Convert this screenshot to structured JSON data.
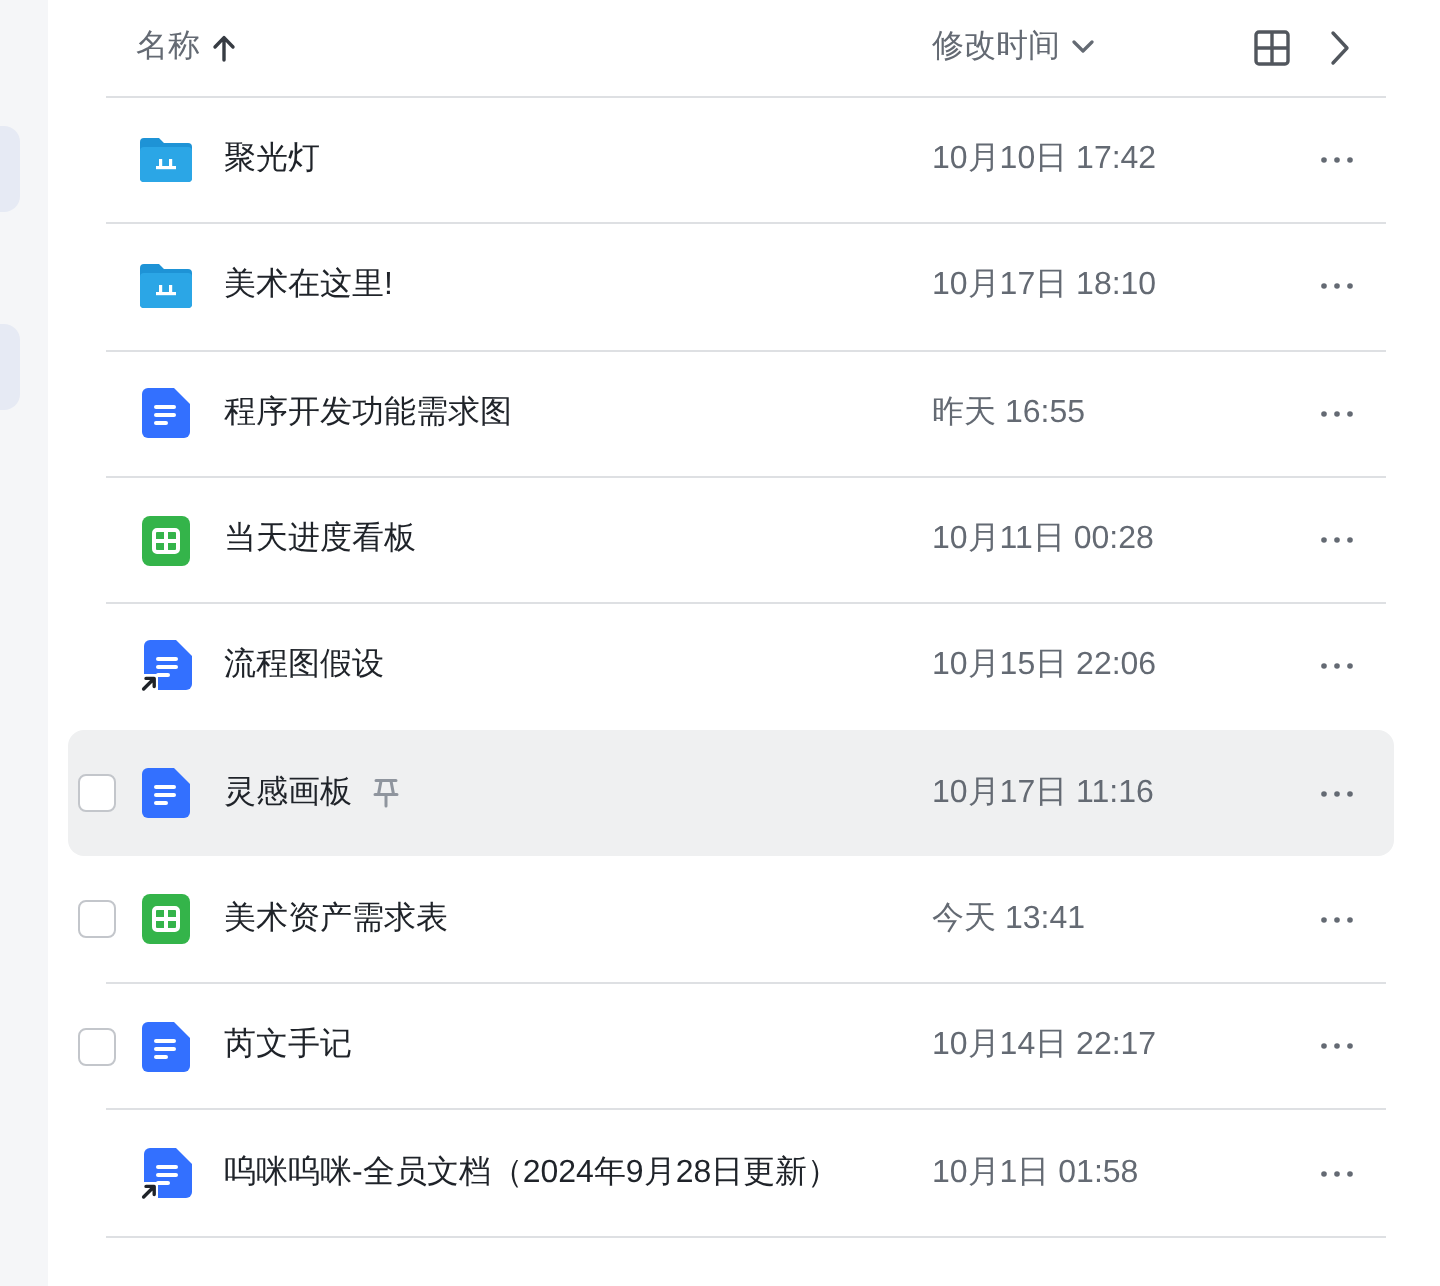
{
  "header": {
    "columns": [
      {
        "label": "名称",
        "sorted": true,
        "dropdown": false
      },
      {
        "label": "修改时间",
        "sorted": false,
        "dropdown": true
      }
    ]
  },
  "files": [
    {
      "name": "聚光灯",
      "kind": "shared-folder",
      "shortcut": false,
      "modified": "10月10日 17:42",
      "hovered": false
    },
    {
      "name": "美术在这里!",
      "kind": "shared-folder",
      "shortcut": false,
      "modified": "10月17日 18:10",
      "hovered": false
    },
    {
      "name": "程序开发功能需求图",
      "kind": "doc",
      "shortcut": false,
      "modified": "昨天 16:55",
      "hovered": false
    },
    {
      "name": "当天进度看板",
      "kind": "sheet",
      "shortcut": false,
      "modified": "10月11日 00:28",
      "hovered": false
    },
    {
      "name": "流程图假设",
      "kind": "doc",
      "shortcut": true,
      "modified": "10月15日 22:06",
      "hovered": false
    },
    {
      "name": "灵感画板",
      "kind": "doc",
      "shortcut": false,
      "modified": "10月17日 11:16",
      "hovered": true,
      "checkbox": {
        "checked": false
      }
    },
    {
      "name": "美术资产需求表",
      "kind": "sheet",
      "shortcut": false,
      "modified": "今天 13:41",
      "hovered": false,
      "checkbox": {
        "checked": false
      }
    },
    {
      "name": "芮文手记",
      "kind": "doc",
      "shortcut": false,
      "modified": "10月14日 22:17",
      "hovered": false,
      "checkbox": {
        "checked": false
      }
    },
    {
      "name": "呜咪呜咪-全员文档（2024年9月28日更新）",
      "kind": "doc",
      "shortcut": true,
      "modified": "10月1日 01:58",
      "hovered": false
    }
  ]
}
